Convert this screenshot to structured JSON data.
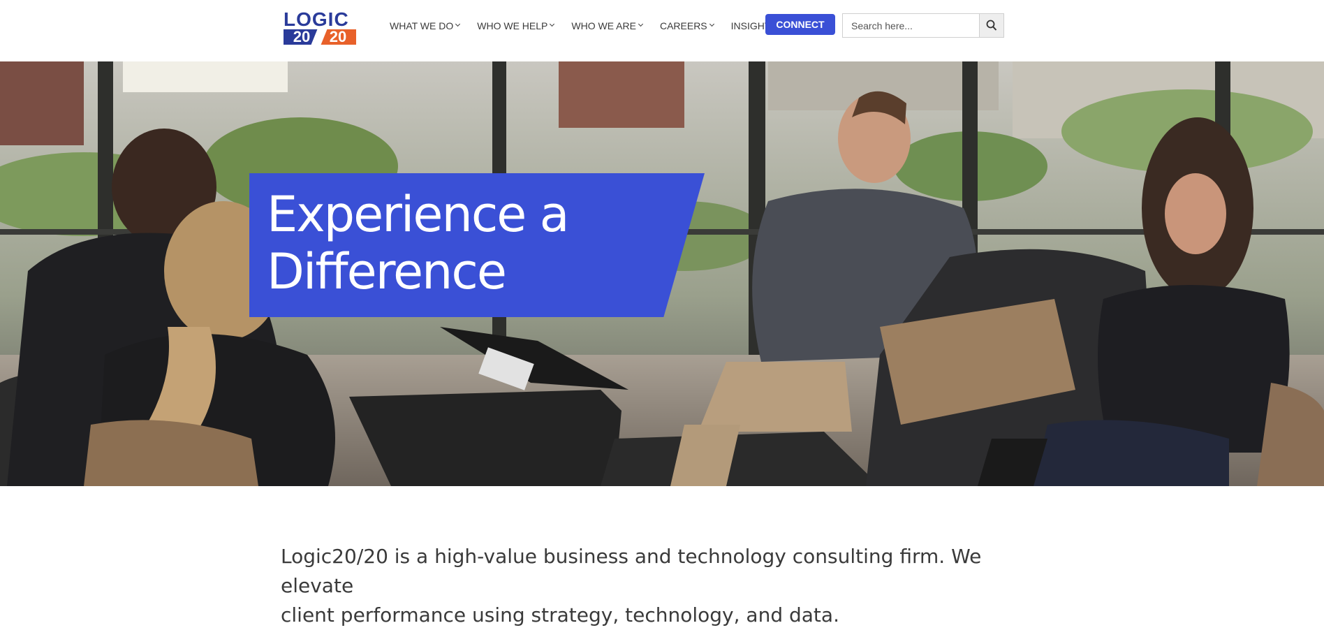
{
  "header": {
    "logo": {
      "word": "LOGIC",
      "num_left": "20",
      "num_right": "20",
      "colors": {
        "navy": "#2a3b9a",
        "orange": "#e8612a"
      }
    },
    "nav": [
      {
        "label": "WHAT WE DO",
        "has_dropdown": true
      },
      {
        "label": "WHO WE HELP",
        "has_dropdown": true
      },
      {
        "label": "WHO WE ARE",
        "has_dropdown": true
      },
      {
        "label": "CAREERS",
        "has_dropdown": true
      },
      {
        "label": "INSIGHTS",
        "has_dropdown": false
      }
    ],
    "connect_label": "CONNECT",
    "search": {
      "placeholder": "Search here...",
      "value": "",
      "icon": "search-icon"
    }
  },
  "hero": {
    "title_line1": "Experience a",
    "title_line2": "Difference",
    "accent_color": "#3a50d6"
  },
  "intro": {
    "line1": "Logic20/20 is a high-value business and technology consulting firm. We elevate",
    "line2": "client performance using strategy, technology, and data."
  }
}
